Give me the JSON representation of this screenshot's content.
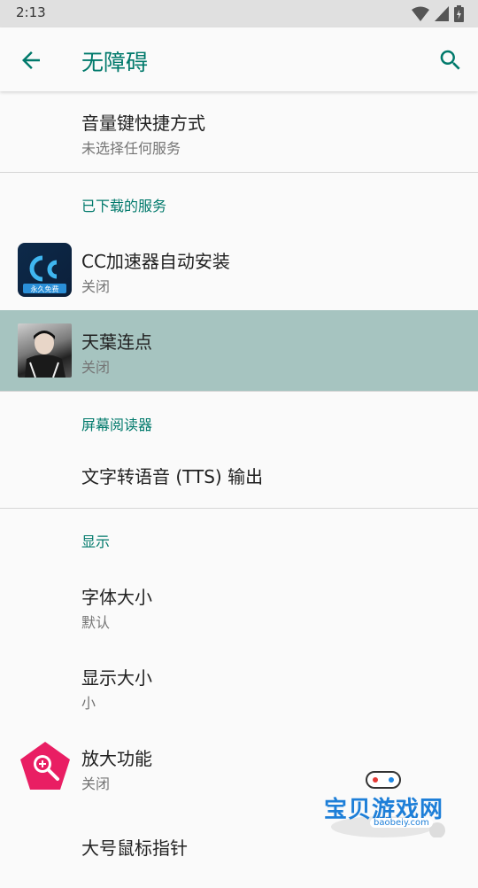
{
  "status": {
    "time": "2:13"
  },
  "appbar": {
    "title": "无障碍",
    "back_icon": "arrow-back-icon",
    "search_icon": "search-icon"
  },
  "items": {
    "volume_shortcut": {
      "title": "音量键快捷方式",
      "summary": "未选择任何服务"
    },
    "cc_accelerator": {
      "title": "CC加速器自动安装",
      "summary": "关闭"
    },
    "tianye_clicker": {
      "title": "天葉连点",
      "summary": "关闭"
    },
    "tts_output": {
      "title": "文字转语音 (TTS) 输出"
    },
    "font_size": {
      "title": "字体大小",
      "summary": "默认"
    },
    "display_size": {
      "title": "显示大小",
      "summary": "小"
    },
    "magnification": {
      "title": "放大功能",
      "summary": "关闭"
    },
    "large_pointer": {
      "title": "大号鼠标指针"
    }
  },
  "headers": {
    "downloaded": "已下载的服务",
    "screen_reader": "屏幕阅读器",
    "display": "显示"
  },
  "cc_icon_badge": "永久免费",
  "watermark": {
    "text": "宝贝游戏网",
    "sub": "baobeiy.com"
  },
  "colors": {
    "accent": "#00796b",
    "selected_bg": "#a6c4c0",
    "magnify_icon": "#e91e63"
  }
}
